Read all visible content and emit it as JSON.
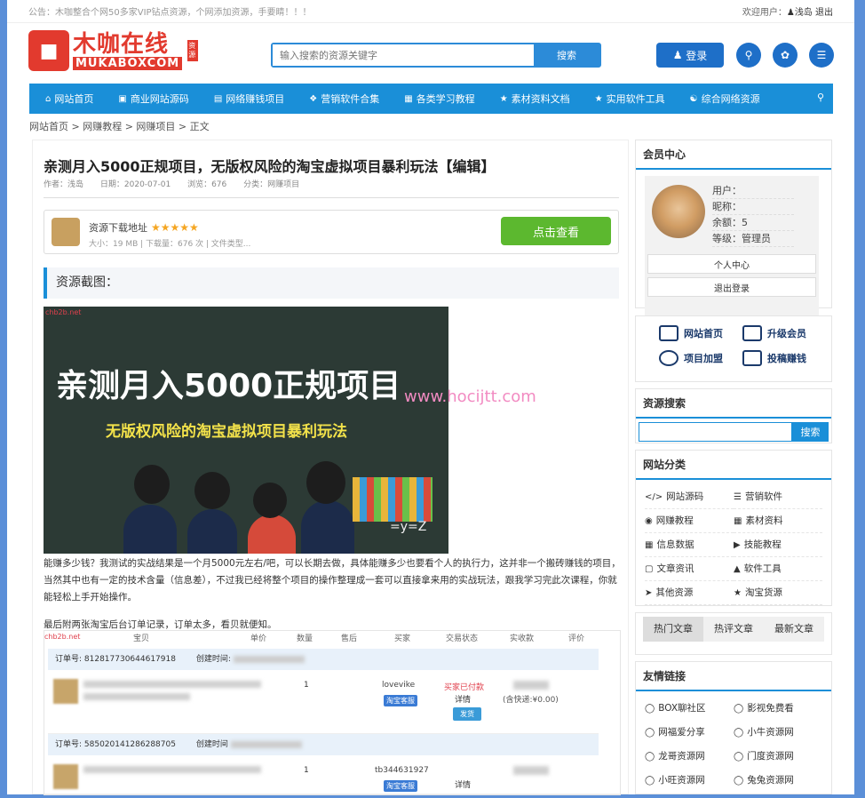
{
  "topbar": {
    "notice": "公告：木咖整合个网50多家VIP钻点资源，个网添加资源，手要睛！！！",
    "welcome": "欢迎用户：",
    "user": "浅岛",
    "logout": "退出"
  },
  "logo": {
    "cn": "木咖在线",
    "en": "MUKABOXCOM",
    "tag": "资源"
  },
  "search": {
    "placeholder": "输入搜索的资源关键字",
    "button": "搜索"
  },
  "header": {
    "login": "登录"
  },
  "nav": [
    {
      "label": "网站首页",
      "icon": "home-icon"
    },
    {
      "label": "商业网站源码",
      "icon": "briefcase-icon"
    },
    {
      "label": "网络赚钱项目",
      "icon": "money-icon"
    },
    {
      "label": "营销软件合集",
      "icon": "dropbox-icon"
    },
    {
      "label": "各类学习教程",
      "icon": "film-icon"
    },
    {
      "label": "素材资料文档",
      "icon": "star-icon"
    },
    {
      "label": "实用软件工具",
      "icon": "star-icon"
    },
    {
      "label": "综合网络资源",
      "icon": "users-icon"
    }
  ],
  "breadcrumb": "网站首页 > 网赚教程 > 网赚项目 > 正文",
  "article": {
    "title": "亲测月入5000正规项目，无版权风险的淘宝虚拟项目暴利玩法【编辑】",
    "author": "作者：浅岛",
    "date": "日期：2020-07-01",
    "views": "浏览：676",
    "category": "分类：网赚项目",
    "download_title": "资源下载地址",
    "stars": "★★★★★",
    "download_info": "大小：19 MB | 下载量：676 次 | 文件类型...",
    "download_button": "点击查看",
    "section": "资源截图：",
    "img_watermark": "chb2b.net",
    "img_title": "亲测月入5000正规项目",
    "img_subtitle": "无版权风险的淘宝虚拟项目暴利玩法",
    "img_eq": "=y=Z",
    "overlay_watermark": "www.hocijtt.com",
    "para1": "能赚多少钱？我测试的实战结果是一个月5000元左右/吧，可以长期去做，具体能赚多少也要看个人的执行力，这并非一个搬砖赚钱的项目，当然其中也有一定的技术含量（信息差），不过我已经将整个项目的操作整理成一套可以直接拿来用的实战玩法，跟我学习完此次课程，你就能轻松上手开始操作。",
    "para2": "最后附两张淘宝后台订单记录，订单太多，看贝就便知。",
    "table": {
      "headers": [
        "宝贝",
        "单价",
        "数量",
        "售后",
        "买家",
        "交易状态",
        "实收款",
        "评价"
      ],
      "orders": [
        {
          "order_no": "订单号: 812817730644617918",
          "created": "创建时间:",
          "buyer": "lovevike",
          "status": "买家已付款",
          "detail": "详情",
          "ship": "发货",
          "paid": "(含快递:¥0.00)",
          "qty": "1"
        },
        {
          "order_no": "订单号: 585020141286288705",
          "created": "创建时间",
          "buyer": "tb344631927",
          "status": "",
          "detail": "详情",
          "ship": "",
          "paid": "",
          "qty": "1"
        }
      ],
      "buyer_badge": "淘宝客服"
    }
  },
  "sidebar": {
    "member_title": "会员中心",
    "user_label": "用户：",
    "nick_label": "昵称：",
    "balance_label": "余额：5",
    "level_label": "等级：管理员",
    "center_button": "个人中心",
    "logout_button": "退出登录",
    "quick": [
      "网站首页",
      "升级会员",
      "项目加盟",
      "投稿赚钱"
    ],
    "search_title": "资源搜索",
    "search_button": "搜索",
    "cat_title": "网站分类",
    "cats": [
      {
        "label": "网站源码",
        "icon": "code-icon"
      },
      {
        "label": "营销软件",
        "icon": "list-icon"
      },
      {
        "label": "网赚教程",
        "icon": "camera-icon"
      },
      {
        "label": "素材资料",
        "icon": "grid-icon"
      },
      {
        "label": "信息数据",
        "icon": "table-icon"
      },
      {
        "label": "技能教程",
        "icon": "video-icon"
      },
      {
        "label": "文章资讯",
        "icon": "document-icon"
      },
      {
        "label": "软件工具",
        "icon": "bank-icon"
      },
      {
        "label": "其他资源",
        "icon": "send-icon"
      },
      {
        "label": "淘宝货源",
        "icon": "star-icon"
      }
    ],
    "tabs": [
      "热门文章",
      "热评文章",
      "最新文章"
    ],
    "links_title": "友情链接",
    "links": [
      "BOX聊社区",
      "影视免费看",
      "网福爱分享",
      "小牛资源网",
      "龙哥资源网",
      "门度资源网",
      "小旺资源网",
      "兔兔资源网"
    ]
  }
}
